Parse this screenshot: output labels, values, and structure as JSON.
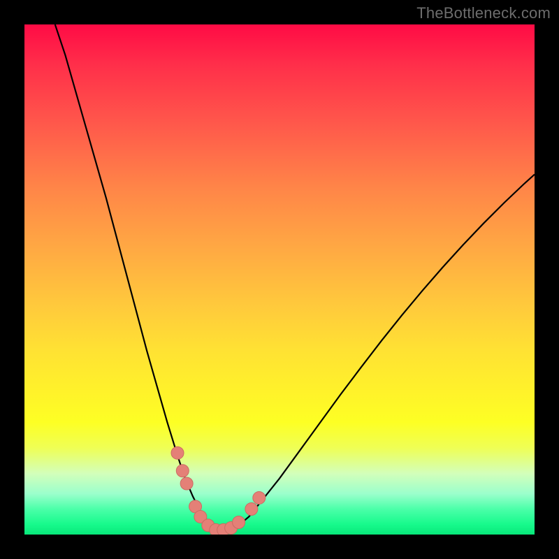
{
  "watermark": "TheBottleneck.com",
  "colors": {
    "background": "#000000",
    "curve": "#000000",
    "marker_fill": "#e48077",
    "marker_stroke": "#cc6b62"
  },
  "chart_data": {
    "type": "line",
    "title": "",
    "xlabel": "",
    "ylabel": "",
    "xlim": [
      0,
      100
    ],
    "ylim": [
      0,
      100
    ],
    "grid": false,
    "series": [
      {
        "name": "curve",
        "x": [
          6,
          8,
          10,
          12,
          14,
          16,
          18,
          20,
          22,
          24,
          26,
          28,
          30,
          31.5,
          33,
          34.5,
          36,
          37.5,
          39,
          40.5,
          42,
          44,
          46,
          50,
          54,
          58,
          62,
          66,
          70,
          74,
          78,
          82,
          86,
          90,
          94,
          98,
          100
        ],
        "y": [
          100,
          94,
          87,
          80,
          73,
          66,
          58.5,
          51,
          43.5,
          36,
          29,
          22,
          15.5,
          11,
          7.5,
          4.5,
          2.5,
          1.4,
          0.9,
          1.0,
          1.8,
          3.5,
          6,
          11,
          16.5,
          22,
          27.5,
          32.8,
          38,
          43,
          47.8,
          52.4,
          56.8,
          61,
          65,
          68.8,
          70.6
        ]
      }
    ],
    "markers": [
      {
        "x": 30.0,
        "y": 16.0
      },
      {
        "x": 31.0,
        "y": 12.5
      },
      {
        "x": 31.8,
        "y": 10.0
      },
      {
        "x": 33.5,
        "y": 5.5
      },
      {
        "x": 34.5,
        "y": 3.5
      },
      {
        "x": 36.0,
        "y": 1.8
      },
      {
        "x": 37.5,
        "y": 0.9
      },
      {
        "x": 39.0,
        "y": 0.9
      },
      {
        "x": 40.5,
        "y": 1.3
      },
      {
        "x": 42.0,
        "y": 2.4
      },
      {
        "x": 44.5,
        "y": 5.0
      },
      {
        "x": 46.0,
        "y": 7.2
      }
    ],
    "marker_radius": 9
  }
}
